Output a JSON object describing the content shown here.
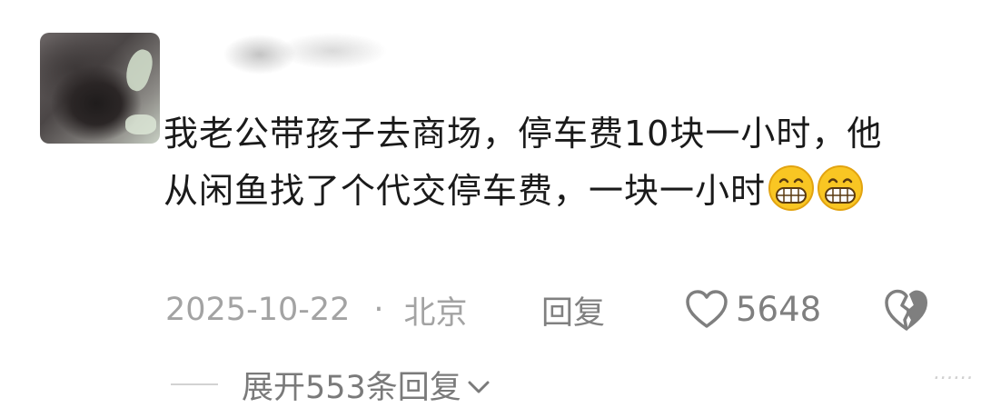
{
  "comment": {
    "text": "我老公带孩子去商场，停车费10块一小时，他从闲鱼找了个代交停车费，一块一小时",
    "emoji": [
      "grinning-face-emoji",
      "grinning-face-emoji"
    ]
  },
  "meta": {
    "date": "2025-10-22",
    "separator": "·",
    "location": "北京"
  },
  "actions": {
    "reply_label": "回复",
    "like_count": "5648",
    "like_icon": "heart-outline-icon",
    "dislike_icon": "broken-heart-icon"
  },
  "replies": {
    "expand_label": "展开553条回复",
    "chevron_icon": "chevron-down-icon"
  },
  "watermark": "……"
}
